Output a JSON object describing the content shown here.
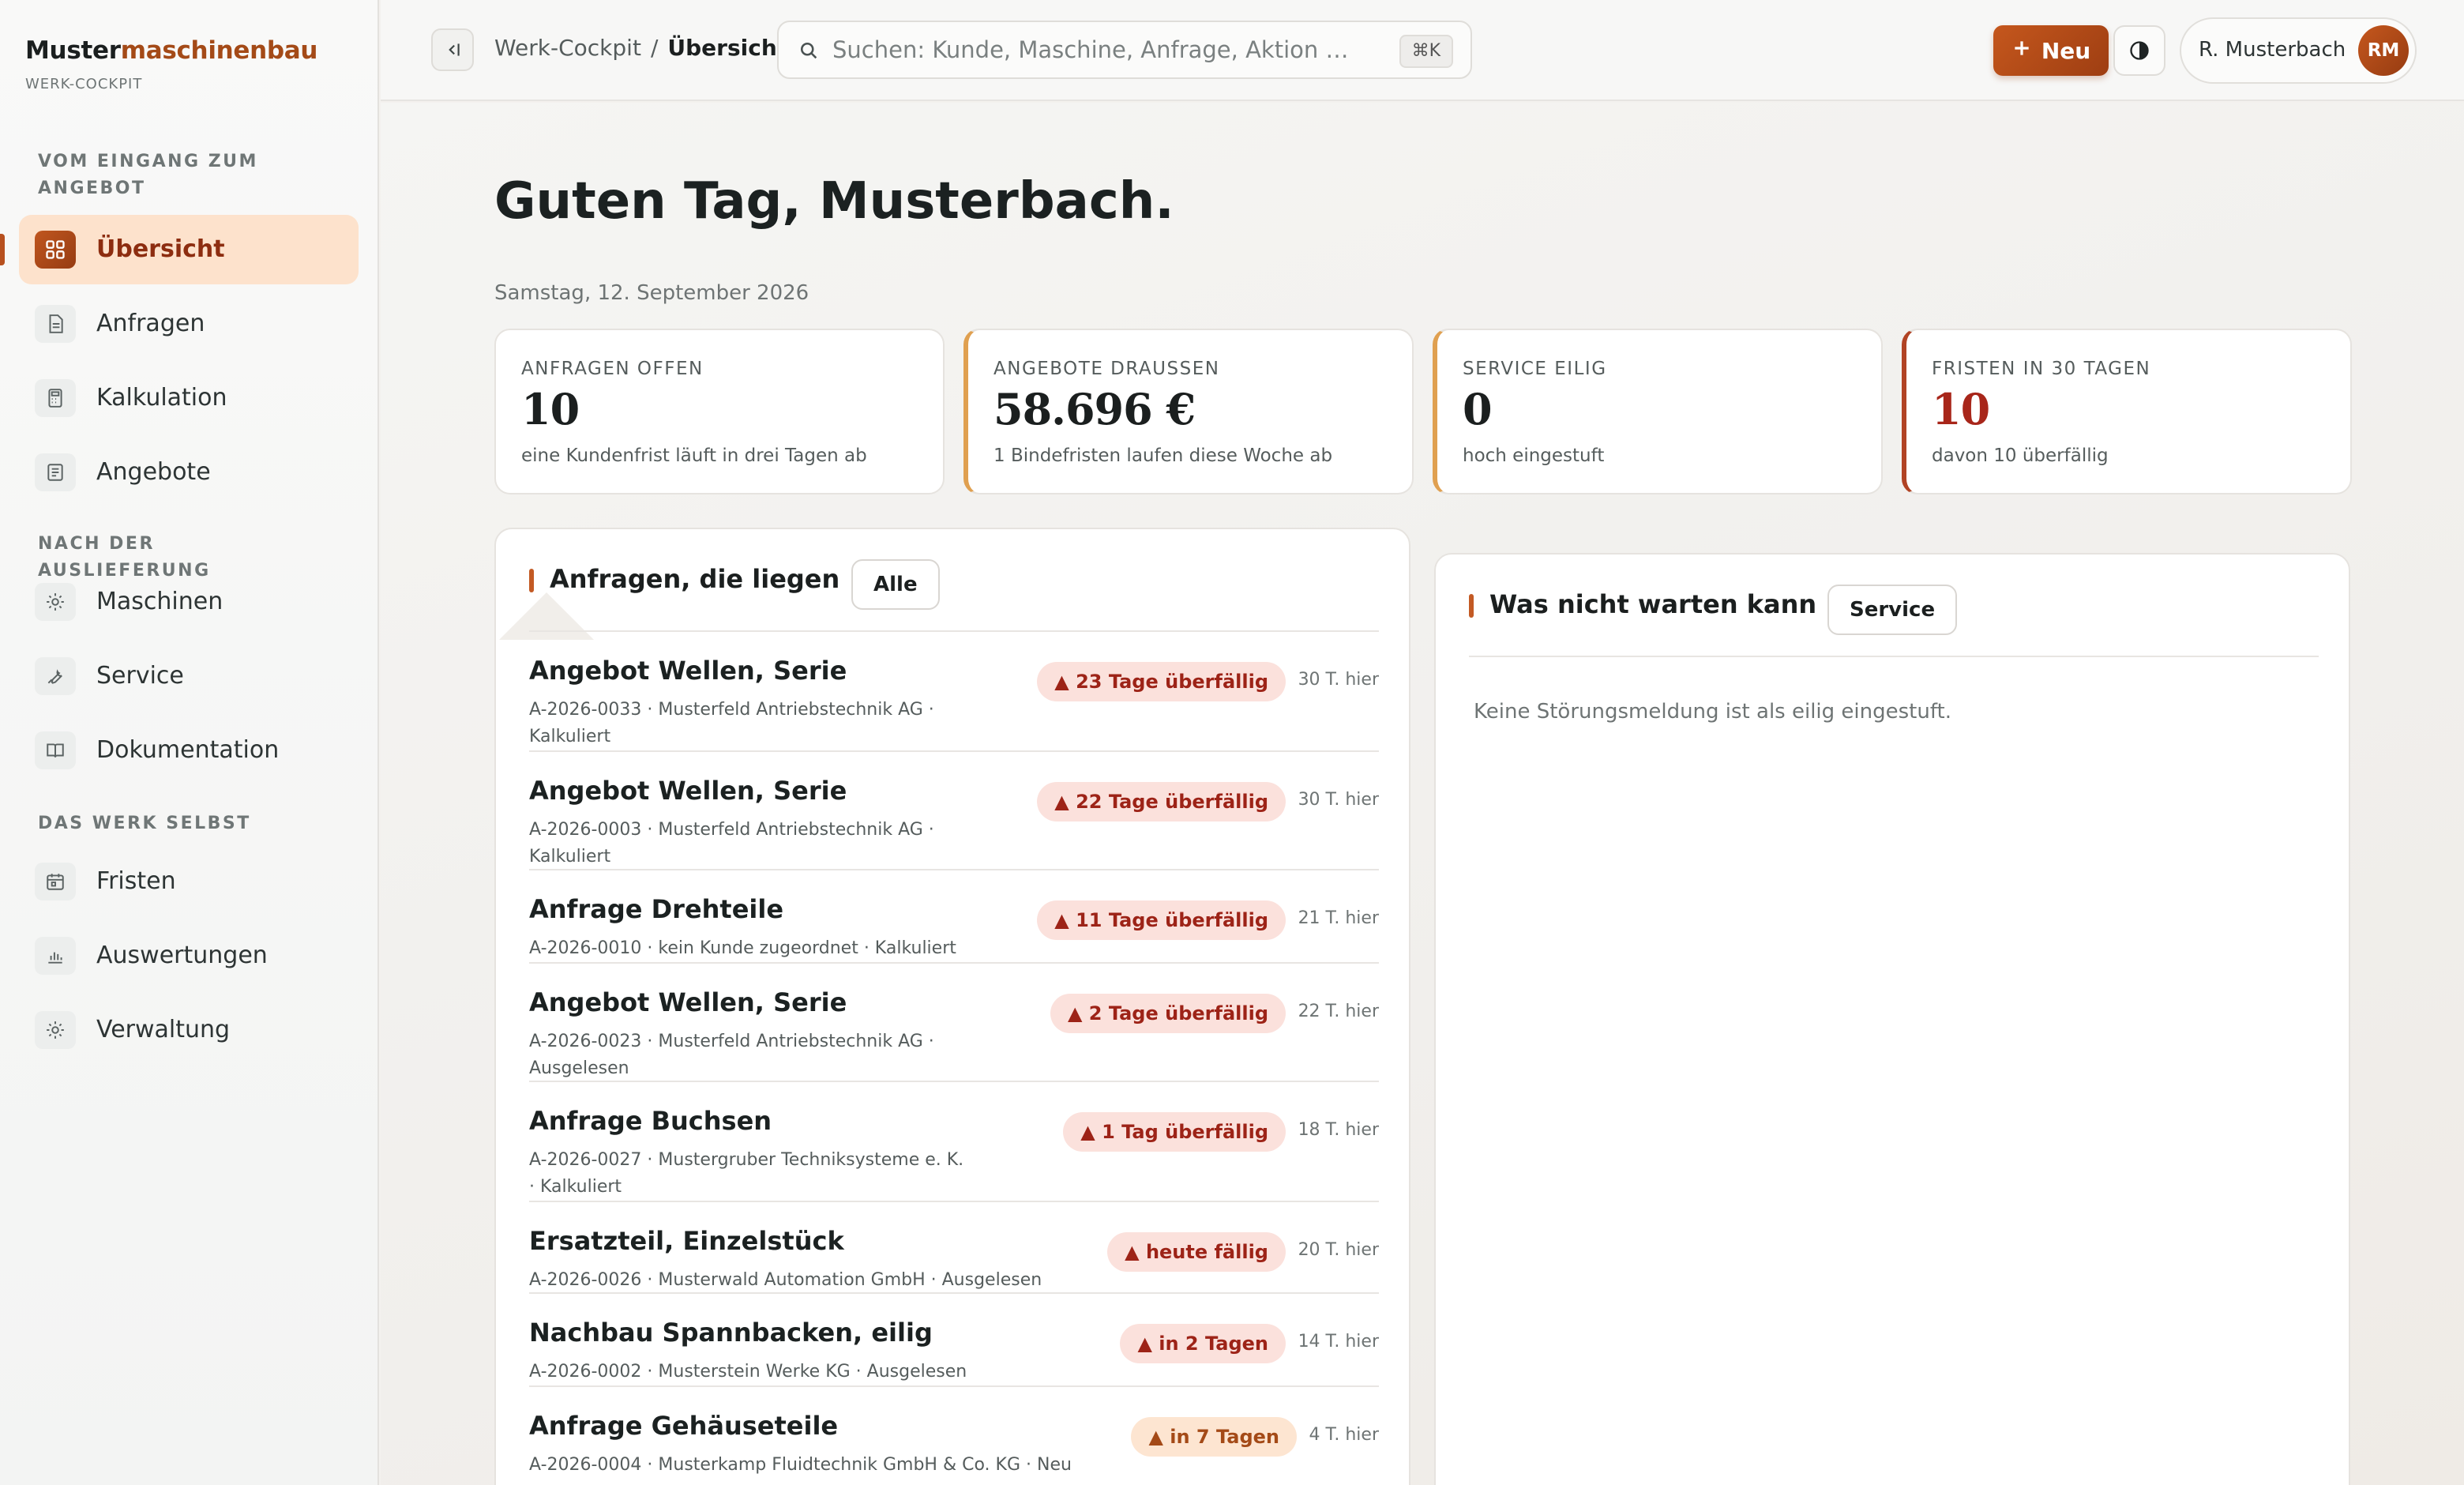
{
  "brand": {
    "name_prefix": "Muster",
    "name_suffix": "maschinenbau",
    "subtitle": "WERK-COCKPIT"
  },
  "sidebar": {
    "sections": [
      {
        "title": "VOM EINGANG ZUM ANGEBOT"
      },
      {
        "title": "NACH DER AUSLIEFERUNG"
      },
      {
        "title": "DAS WERK SELBST"
      }
    ],
    "items": [
      {
        "label": "Übersicht",
        "icon": "grid-icon",
        "active": true
      },
      {
        "label": "Anfragen",
        "icon": "document-icon"
      },
      {
        "label": "Kalkulation",
        "icon": "calculator-icon"
      },
      {
        "label": "Angebote",
        "icon": "receipt-icon"
      },
      {
        "label": "Maschinen",
        "icon": "cog-icon"
      },
      {
        "label": "Service",
        "icon": "wrench-icon"
      },
      {
        "label": "Dokumentation",
        "icon": "book-icon"
      },
      {
        "label": "Fristen",
        "icon": "calendar-icon"
      },
      {
        "label": "Auswertungen",
        "icon": "bar-chart-icon"
      },
      {
        "label": "Verwaltung",
        "icon": "settings-icon"
      }
    ]
  },
  "topbar": {
    "breadcrumb": {
      "parent": "Werk-Cockpit",
      "separator": "/",
      "current": "Übersicht"
    },
    "search": {
      "placeholder": "Suchen: Kunde, Maschine, Anfrage, Aktion …",
      "shortcut": "⌘K"
    },
    "new_button": "Neu",
    "user": {
      "name": "R. Musterbach",
      "initials": "RM"
    }
  },
  "page": {
    "greeting": "Guten Tag, Musterbach.",
    "date": "Samstag, 12. September 2026"
  },
  "kpis": [
    {
      "label": "ANFRAGEN OFFEN",
      "value": "10",
      "sub": "eine Kundenfrist läuft in drei Tagen ab"
    },
    {
      "label": "ANGEBOTE DRAUSSEN",
      "value": "58.696 €",
      "sub": "1 Bindefristen laufen diese Woche ab"
    },
    {
      "label": "SERVICE EILIG",
      "value": "0",
      "sub": "hoch eingestuft"
    },
    {
      "label": "FRISTEN IN 30 TAGEN",
      "value": "10",
      "sub": "davon 10 überfällig"
    }
  ],
  "requests_panel": {
    "title": "Anfragen, die liegen",
    "filter_button": "Alle",
    "rows": [
      {
        "title": "Angebot Wellen, Serie",
        "meta": "A-2026-0033 · Musterfeld Antriebstechnik AG · Kalkuliert",
        "badge": "▲ 23 Tage überfällig",
        "badge_tone": "red",
        "age": "30 T. hier"
      },
      {
        "title": "Angebot Wellen, Serie",
        "meta": "A-2026-0003 · Musterfeld Antriebstechnik AG · Kalkuliert",
        "badge": "▲ 22 Tage überfällig",
        "badge_tone": "red",
        "age": "30 T. hier"
      },
      {
        "title": "Anfrage Drehteile",
        "meta": "A-2026-0010 · kein Kunde zugeordnet · Kalkuliert",
        "badge": "▲ 11 Tage überfällig",
        "badge_tone": "red",
        "age": "21 T. hier"
      },
      {
        "title": "Angebot Wellen, Serie",
        "meta": "A-2026-0023 · Musterfeld Antriebstechnik AG · Ausgelesen",
        "badge": "▲ 2 Tage überfällig",
        "badge_tone": "red",
        "age": "22 T. hier"
      },
      {
        "title": "Anfrage Buchsen",
        "meta": "A-2026-0027 · Mustergruber Techniksysteme e. K. · Kalkuliert",
        "badge": "▲ 1 Tag überfällig",
        "badge_tone": "red",
        "age": "18 T. hier"
      },
      {
        "title": "Ersatzteil, Einzelstück",
        "meta": "A-2026-0026 · Musterwald Automation GmbH · Ausgelesen",
        "badge": "▲ heute fällig",
        "badge_tone": "red",
        "age": "20 T. hier"
      },
      {
        "title": "Nachbau Spannbacken, eilig",
        "meta": "A-2026-0002 · Musterstein Werke KG · Ausgelesen",
        "badge": "▲ in 2 Tagen",
        "badge_tone": "red",
        "age": "14 T. hier"
      },
      {
        "title": "Anfrage Gehäuseteile",
        "meta": "A-2026-0004 · Musterkamp Fluidtechnik GmbH & Co. KG · Neu",
        "badge": "▲ in 7 Tagen",
        "badge_tone": "orange",
        "age": "4 T. hier"
      }
    ]
  },
  "urgent_panel": {
    "title": "Was nicht warten kann",
    "filter_button": "Service",
    "empty_text": "Keine Störungsmeldung ist als eilig eingestuft."
  },
  "colors": {
    "accent": "#b7501e",
    "danger": "#a8261a",
    "warning": "#e0a050"
  }
}
